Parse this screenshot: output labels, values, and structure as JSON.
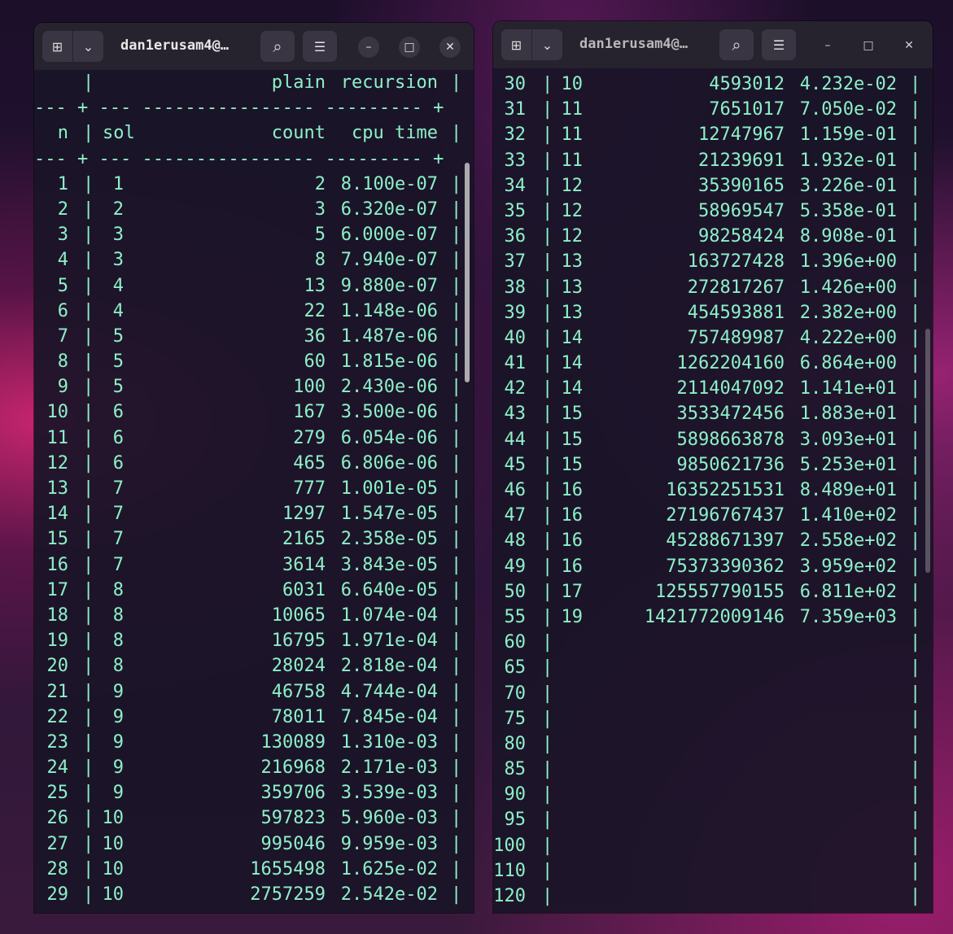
{
  "left_window": {
    "title": "dan1erusam4@…",
    "header1": {
      "bar": "|",
      "plain": "plain",
      "recursion": "recursion",
      "end": "|"
    },
    "sep_line": "--- + --- ---------------- --------- +",
    "header2": {
      "n": "n",
      "bar": "|",
      "sol": "sol",
      "count": "count",
      "cpu": "cpu time",
      "end": "|"
    },
    "rows": [
      {
        "n": "1",
        "sol": "1",
        "count": "2",
        "cpu": "8.100e-07"
      },
      {
        "n": "2",
        "sol": "2",
        "count": "3",
        "cpu": "6.320e-07"
      },
      {
        "n": "3",
        "sol": "3",
        "count": "5",
        "cpu": "6.000e-07"
      },
      {
        "n": "4",
        "sol": "3",
        "count": "8",
        "cpu": "7.940e-07"
      },
      {
        "n": "5",
        "sol": "4",
        "count": "13",
        "cpu": "9.880e-07"
      },
      {
        "n": "6",
        "sol": "4",
        "count": "22",
        "cpu": "1.148e-06"
      },
      {
        "n": "7",
        "sol": "5",
        "count": "36",
        "cpu": "1.487e-06"
      },
      {
        "n": "8",
        "sol": "5",
        "count": "60",
        "cpu": "1.815e-06"
      },
      {
        "n": "9",
        "sol": "5",
        "count": "100",
        "cpu": "2.430e-06"
      },
      {
        "n": "10",
        "sol": "6",
        "count": "167",
        "cpu": "3.500e-06"
      },
      {
        "n": "11",
        "sol": "6",
        "count": "279",
        "cpu": "6.054e-06"
      },
      {
        "n": "12",
        "sol": "6",
        "count": "465",
        "cpu": "6.806e-06"
      },
      {
        "n": "13",
        "sol": "7",
        "count": "777",
        "cpu": "1.001e-05"
      },
      {
        "n": "14",
        "sol": "7",
        "count": "1297",
        "cpu": "1.547e-05"
      },
      {
        "n": "15",
        "sol": "7",
        "count": "2165",
        "cpu": "2.358e-05"
      },
      {
        "n": "16",
        "sol": "7",
        "count": "3614",
        "cpu": "3.843e-05"
      },
      {
        "n": "17",
        "sol": "8",
        "count": "6031",
        "cpu": "6.640e-05"
      },
      {
        "n": "18",
        "sol": "8",
        "count": "10065",
        "cpu": "1.074e-04"
      },
      {
        "n": "19",
        "sol": "8",
        "count": "16795",
        "cpu": "1.971e-04"
      },
      {
        "n": "20",
        "sol": "8",
        "count": "28024",
        "cpu": "2.818e-04"
      },
      {
        "n": "21",
        "sol": "9",
        "count": "46758",
        "cpu": "4.744e-04"
      },
      {
        "n": "22",
        "sol": "9",
        "count": "78011",
        "cpu": "7.845e-04"
      },
      {
        "n": "23",
        "sol": "9",
        "count": "130089",
        "cpu": "1.310e-03"
      },
      {
        "n": "24",
        "sol": "9",
        "count": "216968",
        "cpu": "2.171e-03"
      },
      {
        "n": "25",
        "sol": "9",
        "count": "359706",
        "cpu": "3.539e-03"
      },
      {
        "n": "26",
        "sol": "10",
        "count": "597823",
        "cpu": "5.960e-03"
      },
      {
        "n": "27",
        "sol": "10",
        "count": "995046",
        "cpu": "9.959e-03"
      },
      {
        "n": "28",
        "sol": "10",
        "count": "1655498",
        "cpu": "1.625e-02"
      },
      {
        "n": "29",
        "sol": "10",
        "count": "2757259",
        "cpu": "2.542e-02"
      }
    ]
  },
  "right_window": {
    "title": "dan1erusam4@…",
    "rows": [
      {
        "n": "30",
        "sol": "10",
        "count": "4593012",
        "cpu": "4.232e-02"
      },
      {
        "n": "31",
        "sol": "11",
        "count": "7651017",
        "cpu": "7.050e-02"
      },
      {
        "n": "32",
        "sol": "11",
        "count": "12747967",
        "cpu": "1.159e-01"
      },
      {
        "n": "33",
        "sol": "11",
        "count": "21239691",
        "cpu": "1.932e-01"
      },
      {
        "n": "34",
        "sol": "12",
        "count": "35390165",
        "cpu": "3.226e-01"
      },
      {
        "n": "35",
        "sol": "12",
        "count": "58969547",
        "cpu": "5.358e-01"
      },
      {
        "n": "36",
        "sol": "12",
        "count": "98258424",
        "cpu": "8.908e-01"
      },
      {
        "n": "37",
        "sol": "13",
        "count": "163727428",
        "cpu": "1.396e+00"
      },
      {
        "n": "38",
        "sol": "13",
        "count": "272817267",
        "cpu": "1.426e+00"
      },
      {
        "n": "39",
        "sol": "13",
        "count": "454593881",
        "cpu": "2.382e+00"
      },
      {
        "n": "40",
        "sol": "14",
        "count": "757489987",
        "cpu": "4.222e+00"
      },
      {
        "n": "41",
        "sol": "14",
        "count": "1262204160",
        "cpu": "6.864e+00"
      },
      {
        "n": "42",
        "sol": "14",
        "count": "2114047092",
        "cpu": "1.141e+01"
      },
      {
        "n": "43",
        "sol": "15",
        "count": "3533472456",
        "cpu": "1.883e+01"
      },
      {
        "n": "44",
        "sol": "15",
        "count": "5898663878",
        "cpu": "3.093e+01"
      },
      {
        "n": "45",
        "sol": "15",
        "count": "9850621736",
        "cpu": "5.253e+01"
      },
      {
        "n": "46",
        "sol": "16",
        "count": "16352251531",
        "cpu": "8.489e+01"
      },
      {
        "n": "47",
        "sol": "16",
        "count": "27196767437",
        "cpu": "1.410e+02"
      },
      {
        "n": "48",
        "sol": "16",
        "count": "45288671397",
        "cpu": "2.558e+02"
      },
      {
        "n": "49",
        "sol": "16",
        "count": "75373390362",
        "cpu": "3.959e+02"
      },
      {
        "n": "50",
        "sol": "17",
        "count": "125557790155",
        "cpu": "6.811e+02"
      },
      {
        "n": "55",
        "sol": "19",
        "count": "1421772009146",
        "cpu": "7.359e+03"
      },
      {
        "n": "60",
        "sol": "",
        "count": "",
        "cpu": ""
      },
      {
        "n": "65",
        "sol": "",
        "count": "",
        "cpu": ""
      },
      {
        "n": "70",
        "sol": "",
        "count": "",
        "cpu": ""
      },
      {
        "n": "75",
        "sol": "",
        "count": "",
        "cpu": ""
      },
      {
        "n": "80",
        "sol": "",
        "count": "",
        "cpu": ""
      },
      {
        "n": "85",
        "sol": "",
        "count": "",
        "cpu": ""
      },
      {
        "n": "90",
        "sol": "",
        "count": "",
        "cpu": ""
      },
      {
        "n": "95",
        "sol": "",
        "count": "",
        "cpu": ""
      },
      {
        "n": "100",
        "sol": "",
        "count": "",
        "cpu": ""
      },
      {
        "n": "110",
        "sol": "",
        "count": "",
        "cpu": ""
      },
      {
        "n": "120",
        "sol": "",
        "count": "",
        "cpu": ""
      }
    ]
  },
  "separator_char": "|",
  "icons": {
    "new_tab": "⊞",
    "dropdown": "⌄",
    "search": "⌕",
    "menu": "☰",
    "minimize": "–",
    "maximize": "□",
    "close": "✕"
  },
  "colors": {
    "terminal_text": "#8df0c8",
    "terminal_bg": "#1a1428",
    "titlebar_bg": "#26222e"
  }
}
